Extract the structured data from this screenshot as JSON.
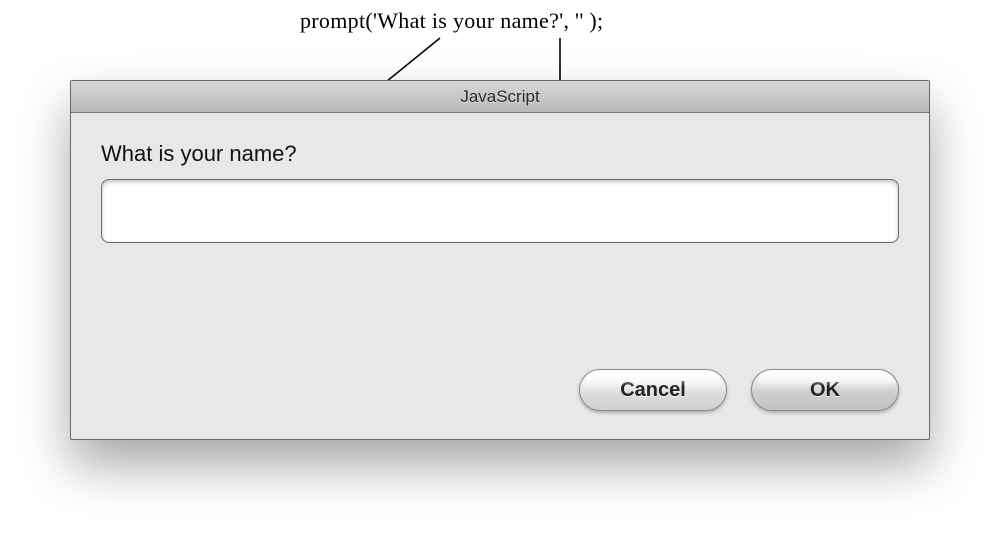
{
  "annotation": {
    "code": "prompt('What is your name?', '' );"
  },
  "dialog": {
    "title": "JavaScript",
    "prompt_text": "What is your name?",
    "input_value": "",
    "input_placeholder": "",
    "buttons": {
      "cancel_label": "Cancel",
      "ok_label": "OK"
    }
  }
}
